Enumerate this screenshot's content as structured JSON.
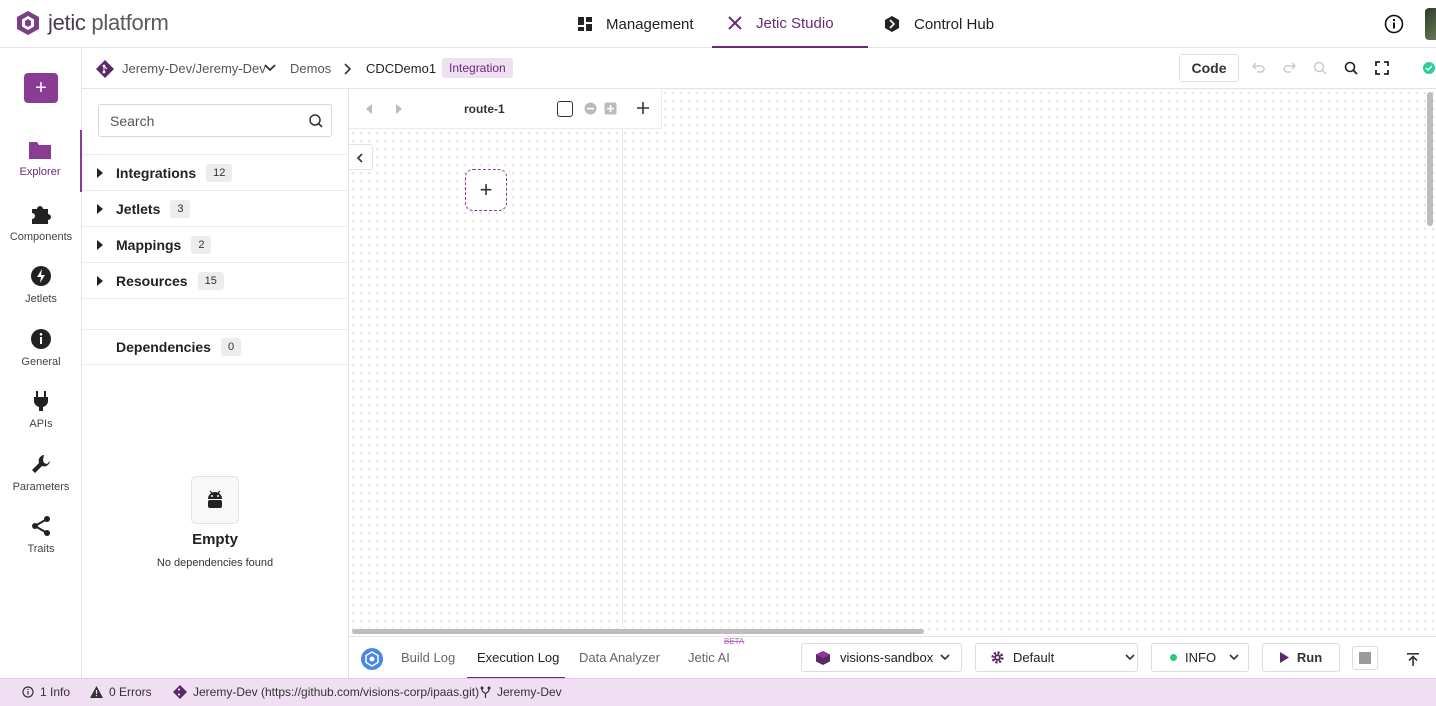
{
  "app": {
    "brand_prefix": "jetic",
    "brand_suffix": " platform"
  },
  "topnav": [
    {
      "label": "Management",
      "icon": "dashboard-icon"
    },
    {
      "label": "Jetic Studio",
      "icon": "tools-icon",
      "active": true
    },
    {
      "label": "Control Hub",
      "icon": "hub-icon"
    }
  ],
  "rail": {
    "add_label": "+",
    "items": [
      {
        "label": "Explorer",
        "icon": "folder-icon",
        "active": true
      },
      {
        "label": "Components",
        "icon": "puzzle-icon"
      },
      {
        "label": "Jetlets",
        "icon": "bolt-icon"
      },
      {
        "label": "General",
        "icon": "info-icon"
      },
      {
        "label": "APIs",
        "icon": "plug-icon"
      },
      {
        "label": "Parameters",
        "icon": "wrench-icon"
      },
      {
        "label": "Traits",
        "icon": "share-icon"
      }
    ]
  },
  "breadcrumb": {
    "repo": "Jeremy-Dev/Jeremy-Dev",
    "folder": "Demos",
    "current": "CDCDemo1",
    "badge": "Integration"
  },
  "toolbar": {
    "code_label": "Code"
  },
  "explorer": {
    "search_placeholder": "Search",
    "groups": [
      {
        "name": "Integrations",
        "count": "12"
      },
      {
        "name": "Jetlets",
        "count": "3"
      },
      {
        "name": "Mappings",
        "count": "2"
      },
      {
        "name": "Resources",
        "count": "15"
      }
    ],
    "dependencies": {
      "name": "Dependencies",
      "count": "0"
    },
    "empty": {
      "title": "Empty",
      "subtitle": "No dependencies found"
    }
  },
  "canvas": {
    "route_label": "route-1",
    "add_step_label": "+"
  },
  "bottom": {
    "tabs": [
      {
        "label": "Build Log"
      },
      {
        "label": "Execution Log",
        "active": true
      },
      {
        "label": "Data Analyzer"
      },
      {
        "label": "Jetic AI"
      }
    ],
    "beta_label": "BETA",
    "environment": "visions-sandbox",
    "profile": "Default",
    "log_level": "INFO",
    "run_label": "Run"
  },
  "status": {
    "info": "1 Info",
    "errors": "0 Errors",
    "repo": "Jeremy-Dev (https://github.com/visions-corp/ipaas.git)",
    "branch": "Jeremy-Dev"
  },
  "colors": {
    "accent": "#6b2a78",
    "accent_button": "#8a3c95",
    "status_bg": "#f0dff2"
  }
}
